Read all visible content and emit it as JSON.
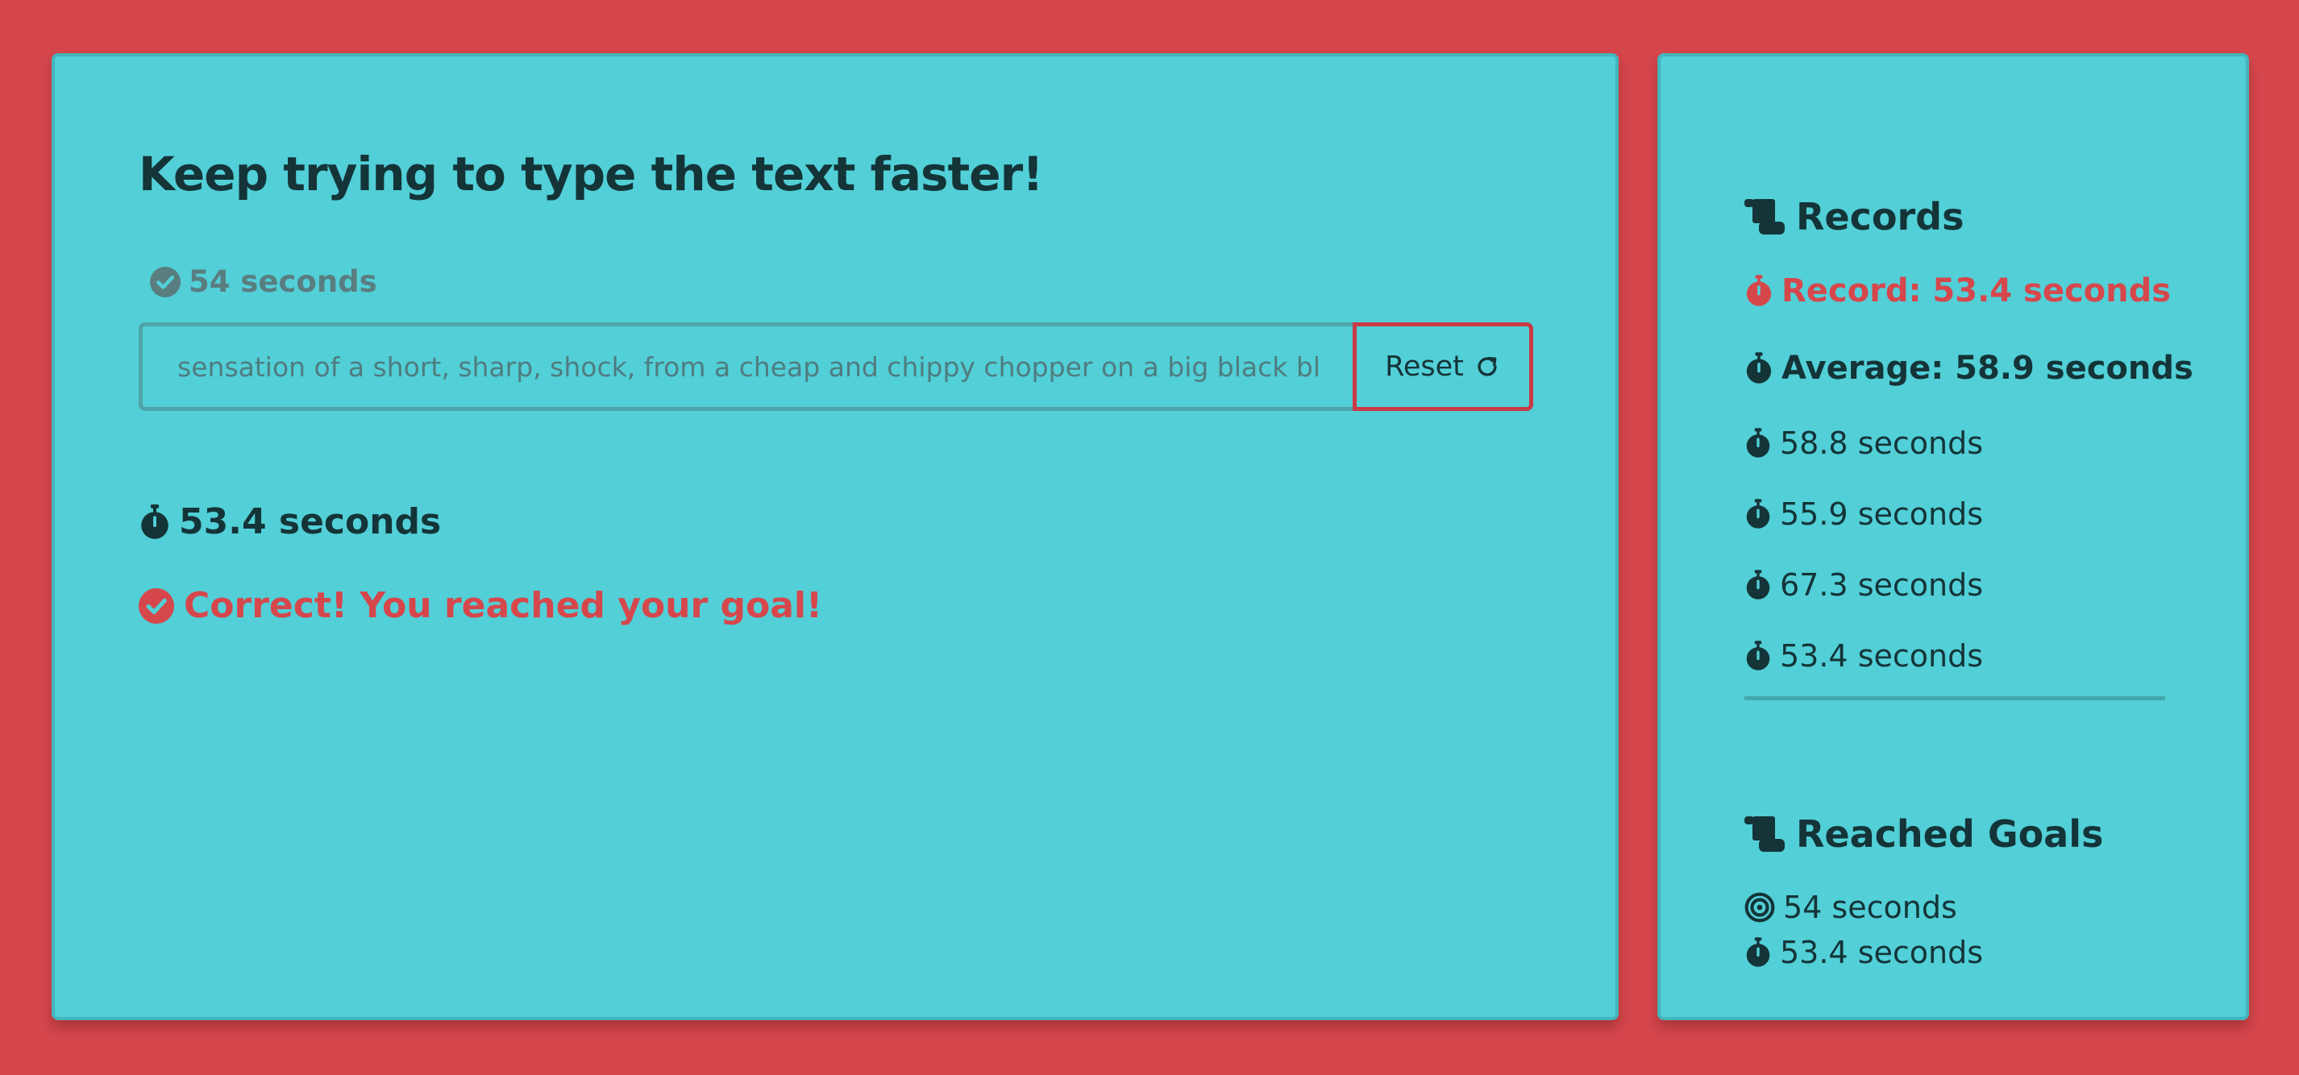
{
  "main": {
    "heading": "Keep trying to type the text faster!",
    "goal_label": "54 seconds",
    "input_value": "e sensation of a short, sharp, shock, from a cheap and chippy chopper on a big black bl",
    "reset_label": "Reset",
    "time_label": "53.4 seconds",
    "result_message": "Correct! You reached your goal!"
  },
  "records": {
    "title": "Records",
    "best": "Record: 53.4 seconds",
    "average": "Average: 58.9 seconds",
    "times": [
      "58.8 seconds",
      "55.9 seconds",
      "67.3 seconds",
      "53.4 seconds"
    ]
  },
  "reached_goals": {
    "title": "Reached Goals",
    "goal": "54 seconds",
    "time": "53.4 seconds"
  },
  "icons": {
    "goal_status": "check-circle-icon",
    "reset": "redo-icon",
    "timer": "stopwatch-icon",
    "result": "check-circle-icon",
    "section": "scroll-icon",
    "target": "bullseye-icon"
  },
  "colors": {
    "background": "#d6474c",
    "panel": "#52cfd7",
    "text": "#143438",
    "accent": "#d6474c",
    "muted": "#5a7d80"
  }
}
